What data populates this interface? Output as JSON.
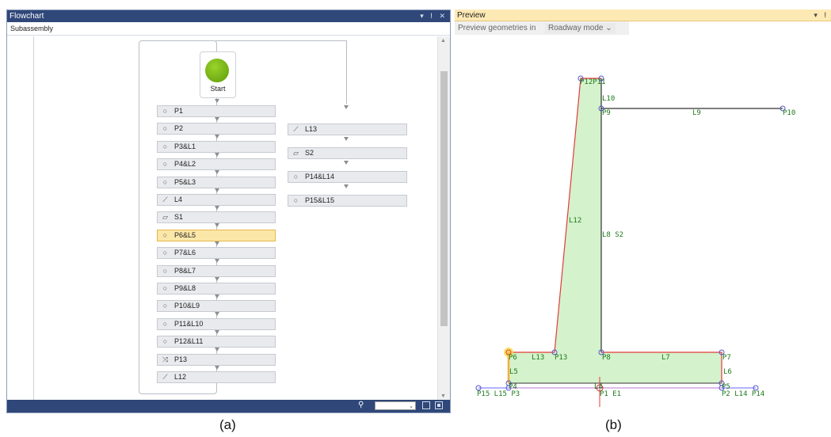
{
  "flowchart": {
    "title": "Flowchart",
    "title_controls": "▾ ⵑ ✕",
    "subheader": "Subassembly",
    "start_label": "Start",
    "zoom_value": "",
    "main_nodes": [
      {
        "label": "P1",
        "icon": "point-icon"
      },
      {
        "label": "P2",
        "icon": "point-icon"
      },
      {
        "label": "P3&L1",
        "icon": "point-icon"
      },
      {
        "label": "P4&L2",
        "icon": "point-icon"
      },
      {
        "label": "P5&L3",
        "icon": "point-icon"
      },
      {
        "label": "L4",
        "icon": "link-icon"
      },
      {
        "label": "S1",
        "icon": "shape-icon"
      },
      {
        "label": "P6&L5",
        "icon": "point-icon",
        "selected": true
      },
      {
        "label": "P7&L6",
        "icon": "point-icon"
      },
      {
        "label": "P8&L7",
        "icon": "point-icon"
      },
      {
        "label": "P9&L8",
        "icon": "point-icon"
      },
      {
        "label": "P10&L9",
        "icon": "point-icon"
      },
      {
        "label": "P11&L10",
        "icon": "point-icon"
      },
      {
        "label": "P12&L11",
        "icon": "point-icon"
      },
      {
        "label": "P13",
        "icon": "intersection-icon"
      },
      {
        "label": "L12",
        "icon": "link-icon"
      }
    ],
    "side_nodes": [
      {
        "label": "L13",
        "icon": "link-icon"
      },
      {
        "label": "S2",
        "icon": "shape-icon"
      },
      {
        "label": "P14&L14",
        "icon": "point-icon"
      },
      {
        "label": "P15&L15",
        "icon": "point-icon"
      }
    ]
  },
  "preview": {
    "title": "Preview",
    "title_controls": "▾ ⵑ",
    "mode_label": "Preview geometries in",
    "mode_value": "Roadway mode",
    "colors": {
      "fill": "#d4f2cc",
      "red": "#e43a3a",
      "point": "#5555cc",
      "label": "#1a7a1a",
      "dark": "#333333",
      "link_blue": "#6a6aff"
    },
    "point_labels": {
      "p12p11": "P12P11",
      "p11": "P11",
      "l10": "L10",
      "p9": "P9",
      "l9": "L9",
      "p10": "P10",
      "l12": "L12",
      "l8s2": "L8  S2",
      "p6": "P6",
      "l13": "L13",
      "p13": "P13",
      "p8": "P8",
      "l7": "L7",
      "p7": "P7",
      "l5": "L5",
      "l6": "L6",
      "p4": "P4",
      "l4": "L4",
      "p5": "P5",
      "p15l15p3": "P15 L15 P3",
      "p1e1": "P1  E1",
      "p2l14p14": "P2  L14 P14"
    }
  },
  "captions": {
    "a": "(a)",
    "b": "(b)"
  }
}
